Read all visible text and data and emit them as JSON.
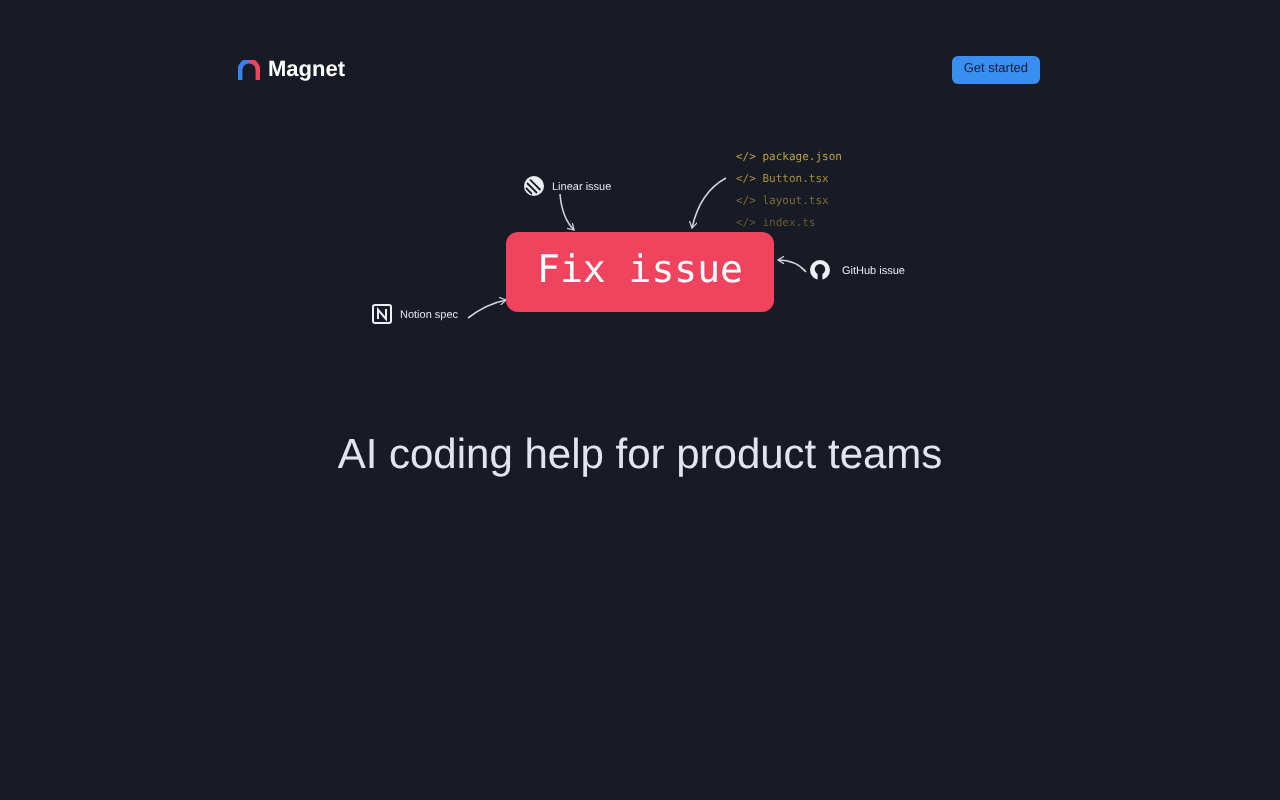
{
  "header": {
    "brand": "Magnet",
    "button": "Get started"
  },
  "diagram": {
    "center": "Fix issue",
    "sources": [
      {
        "kind": "linear",
        "label": "Linear issue"
      },
      {
        "kind": "github",
        "label": "GitHub issue"
      },
      {
        "kind": "notion",
        "label": "Notion spec"
      }
    ],
    "files": [
      {
        "tag": "</>",
        "name": "package.json"
      },
      {
        "tag": "</>",
        "name": "Button.tsx"
      },
      {
        "tag": "</>",
        "name": "layout.tsx"
      },
      {
        "tag": "</>",
        "name": "index.ts"
      }
    ]
  },
  "headline": "AI coding help for product teams"
}
